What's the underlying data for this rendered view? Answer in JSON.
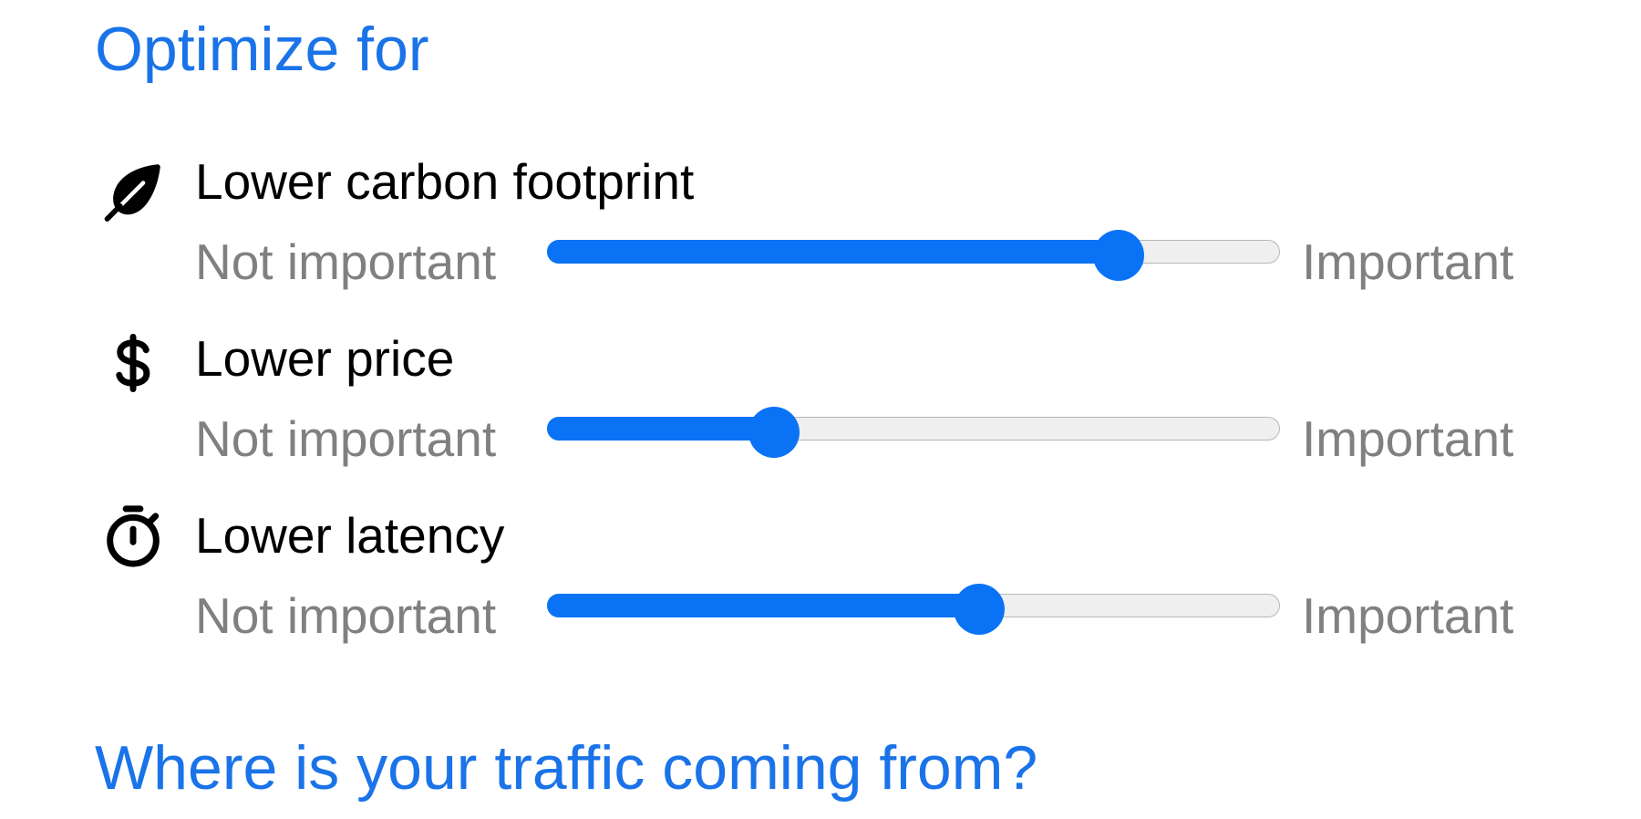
{
  "sections": {
    "optimize_heading": "Optimize for",
    "traffic_heading": "Where is your traffic coming from?"
  },
  "scale": {
    "min_label": "Not important",
    "max_label": "Important"
  },
  "colors": {
    "heading": "#1a73e8",
    "slider_accent": "#0a73f5",
    "slider_track": "#efefef",
    "muted_text": "#808080"
  },
  "criteria": [
    {
      "label": "Lower carbon footprint",
      "icon": "leaf-icon",
      "value": 0.78
    },
    {
      "label": "Lower price",
      "icon": "dollar-icon",
      "value": 0.31
    },
    {
      "label": "Lower latency",
      "icon": "stopwatch-icon",
      "value": 0.59
    }
  ]
}
